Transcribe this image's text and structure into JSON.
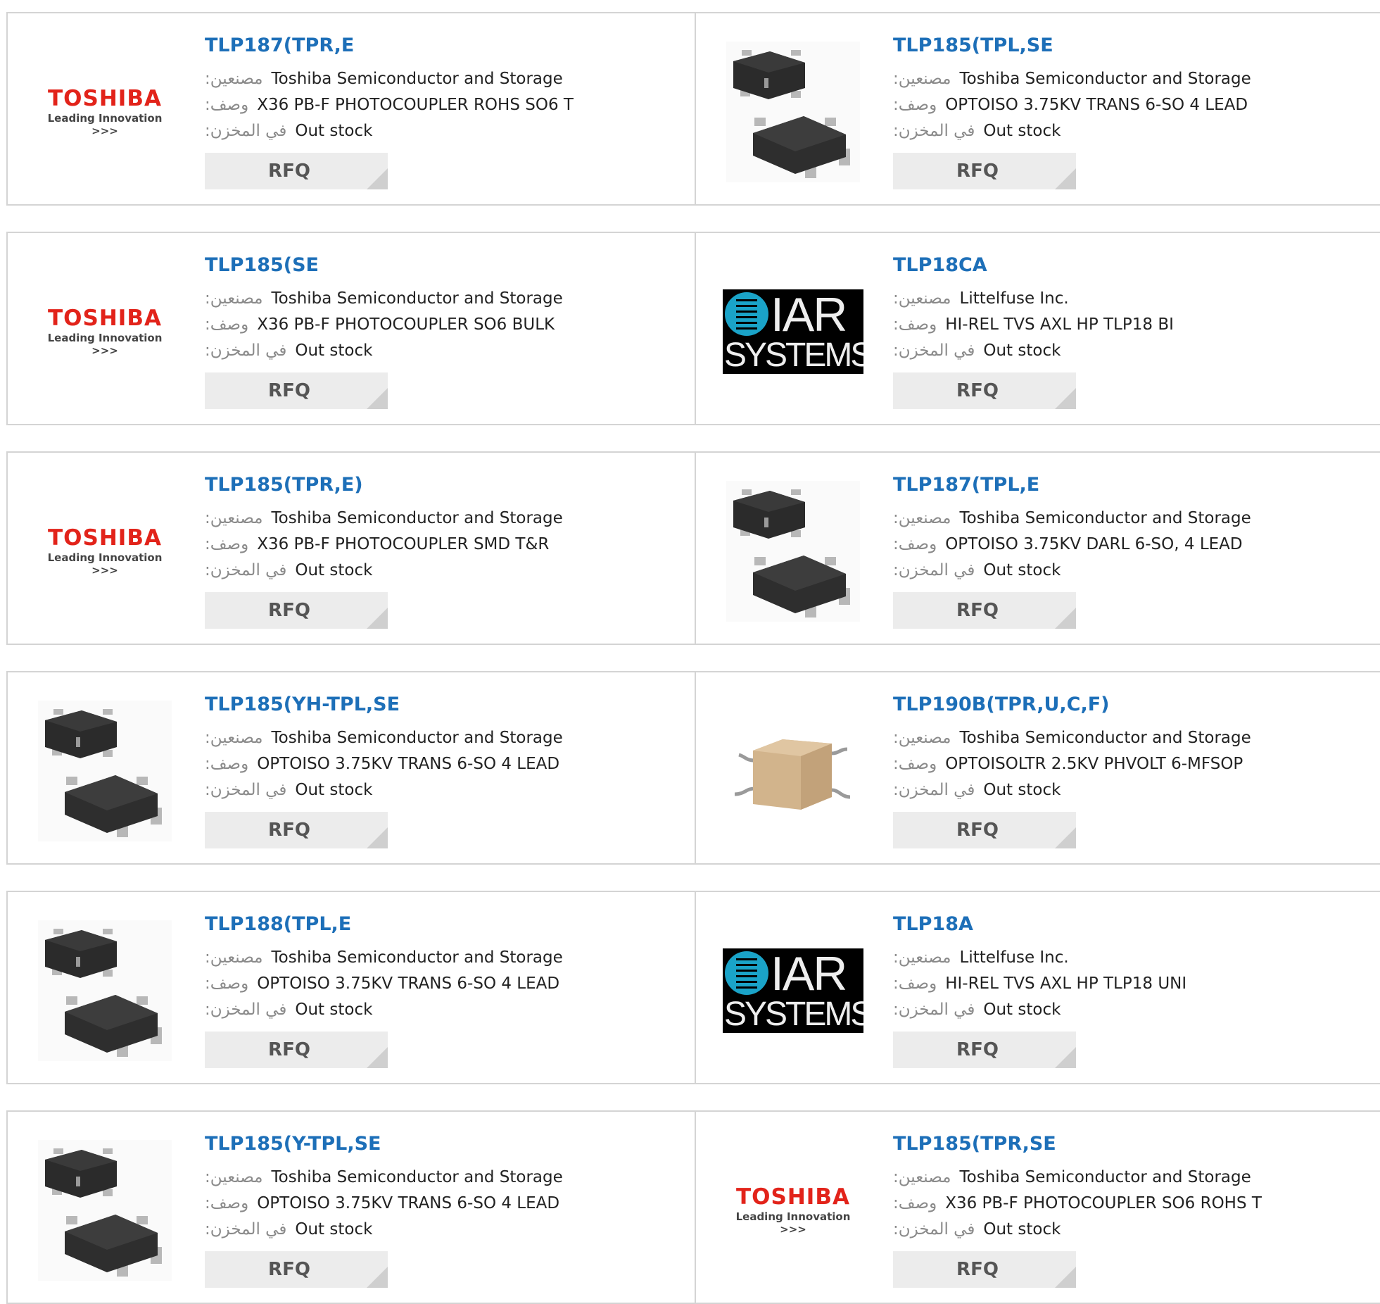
{
  "labels": {
    "manufacturer": ":مصنعين",
    "description": ":وصف",
    "stock": ":في المخزن"
  },
  "rfq_label": "RFQ",
  "logos": {
    "toshiba": {
      "brand": "TOSHIBA",
      "tagline": "Leading Innovation >>>"
    },
    "iar": {
      "line1": "IAR",
      "line2": "SYSTEMS"
    }
  },
  "rows": [
    {
      "left": {
        "title": "TLP187(TPR,E",
        "manufacturer": "Toshiba Semiconductor and Storage",
        "description": "X36 PB-F PHOTOCOUPLER ROHS SO6 T",
        "stock": "Out stock",
        "image": "toshiba-logo"
      },
      "right": {
        "title": "TLP185(TPL,SE",
        "manufacturer": "Toshiba Semiconductor and Storage",
        "description": "OPTOISO 3.75KV TRANS 6-SO 4 LEAD",
        "stock": "Out stock",
        "image": "so6-chip-photo"
      }
    },
    {
      "left": {
        "title": "TLP185(SE",
        "manufacturer": "Toshiba Semiconductor and Storage",
        "description": "X36 PB-F PHOTOCOUPLER SO6 BULK",
        "stock": "Out stock",
        "image": "toshiba-logo"
      },
      "right": {
        "title": "TLP18CA",
        "manufacturer": "Littelfuse Inc.",
        "description": "HI-REL TVS AXL HP TLP18 BI",
        "stock": "Out stock",
        "image": "iar-systems-logo"
      }
    },
    {
      "left": {
        "title": "TLP185(TPR,E)",
        "manufacturer": "Toshiba Semiconductor and Storage",
        "description": "X36 PB-F PHOTOCOUPLER SMD T&R",
        "stock": "Out stock",
        "image": "toshiba-logo"
      },
      "right": {
        "title": "TLP187(TPL,E",
        "manufacturer": "Toshiba Semiconductor and Storage",
        "description": "OPTOISO 3.75KV DARL 6-SO, 4 LEAD",
        "stock": "Out stock",
        "image": "so6-chip-photo"
      }
    },
    {
      "left": {
        "title": "TLP185(YH-TPL,SE",
        "manufacturer": "Toshiba Semiconductor and Storage",
        "description": "OPTOISO 3.75KV TRANS 6-SO 4 LEAD",
        "stock": "Out stock",
        "image": "so6-chip-photo"
      },
      "right": {
        "title": "TLP190B(TPR,U,C,F)",
        "manufacturer": "Toshiba Semiconductor and Storage",
        "description": "OPTOISOLTR 2.5KV PHVOLT 6-MFSOP",
        "stock": "Out stock",
        "image": "mfsop-chip-photo"
      }
    },
    {
      "left": {
        "title": "TLP188(TPL,E",
        "manufacturer": "Toshiba Semiconductor and Storage",
        "description": "OPTOISO 3.75KV TRANS 6-SO 4 LEAD",
        "stock": "Out stock",
        "image": "so6-chip-photo"
      },
      "right": {
        "title": "TLP18A",
        "manufacturer": "Littelfuse Inc.",
        "description": "HI-REL TVS AXL HP TLP18 UNI",
        "stock": "Out stock",
        "image": "iar-systems-logo"
      }
    },
    {
      "left": {
        "title": "TLP185(Y-TPL,SE",
        "manufacturer": "Toshiba Semiconductor and Storage",
        "description": "OPTOISO 3.75KV TRANS 6-SO 4 LEAD",
        "stock": "Out stock",
        "image": "so6-chip-photo"
      },
      "right": {
        "title": "TLP185(TPR,SE",
        "manufacturer": "Toshiba Semiconductor and Storage",
        "description": "X36 PB-F PHOTOCOUPLER SO6 ROHS T",
        "stock": "Out stock",
        "image": "toshiba-logo"
      }
    }
  ]
}
